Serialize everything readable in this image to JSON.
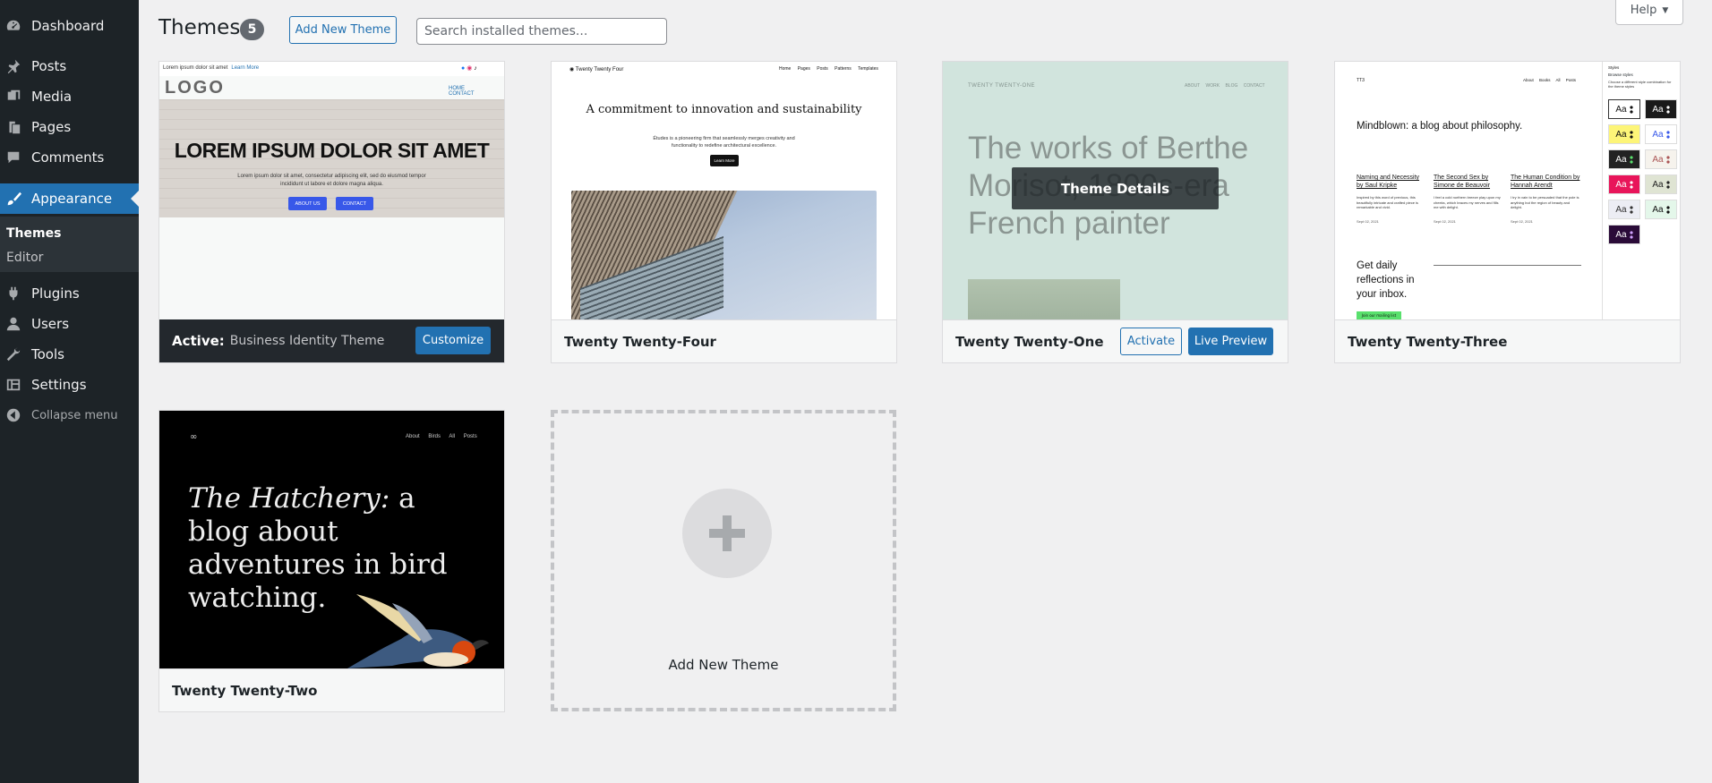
{
  "sidebar": {
    "items": [
      {
        "label": "Dashboard",
        "icon": "dashboard-icon"
      },
      {
        "label": "Posts",
        "icon": "pushpin-icon"
      },
      {
        "label": "Media",
        "icon": "media-icon"
      },
      {
        "label": "Pages",
        "icon": "pages-icon"
      },
      {
        "label": "Comments",
        "icon": "comments-icon"
      },
      {
        "label": "Appearance",
        "icon": "paintbrush-icon"
      },
      {
        "label": "Plugins",
        "icon": "plug-icon"
      },
      {
        "label": "Users",
        "icon": "user-icon"
      },
      {
        "label": "Tools",
        "icon": "wrench-icon"
      },
      {
        "label": "Settings",
        "icon": "settings-icon"
      }
    ],
    "submenu": [
      {
        "label": "Themes"
      },
      {
        "label": "Editor"
      }
    ],
    "collapse": "Collapse menu"
  },
  "header": {
    "title": "Themes",
    "count": "5",
    "add_new": "Add New Theme",
    "search_placeholder": "Search installed themes...",
    "help": "Help"
  },
  "themes": {
    "business": {
      "active_label": "Active:",
      "name": "Business Identity Theme",
      "customize": "Customize",
      "preview": {
        "top_text": "Lorem ipsum dolor sit amet",
        "top_link": "Learn More",
        "logo": "LOGO",
        "nav": [
          "HOME",
          "CONTACT"
        ],
        "hero_title": "LOREM IPSUM DOLOR SIT AMET",
        "hero_sub": "Lorem ipsum dolor sit amet, consectetur adipiscing elit, sed do eiusmod tempor incididunt ut labore et dolore magna aliqua.",
        "btn1": "ABOUT US",
        "btn2": "CONTACT"
      }
    },
    "tt4": {
      "name": "Twenty Twenty-Four",
      "preview": {
        "site": "Twenty Twenty Four",
        "nav": "Home Pages Posts Patterns Templates",
        "title": "A commitment to innovation and sustainability",
        "sub": "Études is a pioneering firm that seamlessly merges creativity and functionality to redefine architectural excellence.",
        "btn": "Learn More"
      }
    },
    "tt1": {
      "name": "Twenty Twenty-One",
      "activate": "Activate",
      "live_preview": "Live Preview",
      "details": "Theme Details",
      "preview": {
        "site": "TWENTY TWENTY-ONE",
        "nav": "ABOUT WORK BLOG CONTACT",
        "title": "The works of Berthe Morisot, 1800s-era French painter"
      }
    },
    "tt3": {
      "name": "Twenty Twenty-Three",
      "preview": {
        "site": "TT3",
        "nav": "About Books All Posts",
        "title": "Mindblown: a blog about philosophy.",
        "cols": [
          {
            "title": "Naming and Necessity by Saul Kripke",
            "text": "Inspired by this word of previous, this beautifully intricate and crafted piece is remarkable and vivid.",
            "date": "Sept 02, 2021"
          },
          {
            "title": "The Second Sex by Simone de Beauvoir",
            "text": "I feel a cold northern breeze play upon my cheeks, which braces my nerves and fills me with delight.",
            "date": "Sept 02, 2021"
          },
          {
            "title": "The Human Condition by Hannah Arendt",
            "text": "I try in vain to be persuaded that the pole is anything but the region of beauty and delight.",
            "date": "Sept 02, 2021"
          }
        ],
        "daily": "Get daily reflections in your inbox.",
        "join": "Join our mailing list",
        "panel_head": "Styles",
        "panel_title": "Browse styles",
        "panel_desc": "Choose a different style combination for the theme styles",
        "aa": "Aa"
      }
    },
    "tt2": {
      "name": "Twenty Twenty-Two",
      "preview": {
        "nav": "About Birds All Posts",
        "title_em": "The Hatchery:",
        "title_rest": " a blog about adventures in bird watching."
      }
    }
  },
  "add_new_card": {
    "label": "Add New Theme"
  },
  "colors": {
    "admin_bg": "#1d2327",
    "accent": "#2271b1",
    "page_bg": "#f0f0f1"
  }
}
